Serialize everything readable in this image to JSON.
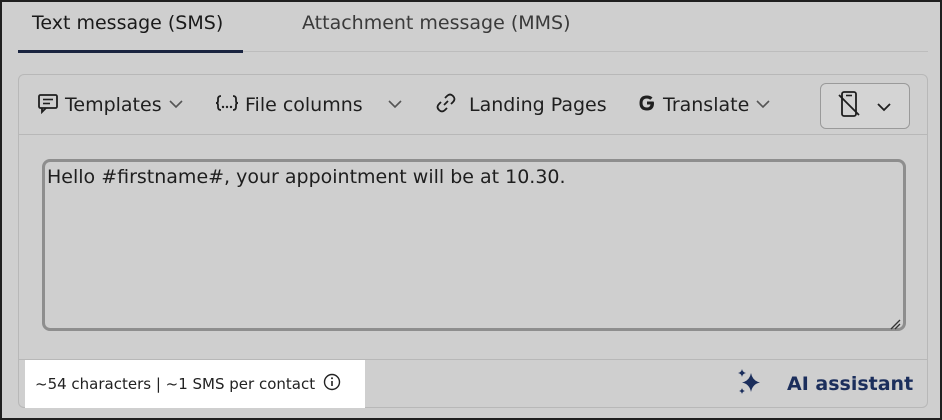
{
  "tabs": [
    {
      "label": "Text message (SMS)",
      "active": true
    },
    {
      "label": "Attachment message (MMS)",
      "active": false
    }
  ],
  "toolbar": {
    "templates_label": "Templates",
    "file_columns_label": "File columns",
    "landing_pages_label": "Landing Pages",
    "translate_label": "Translate"
  },
  "editor": {
    "message_text": "Hello #firstname#, your appointment will be at 10.30."
  },
  "footer": {
    "counter_text": "~54 characters | ~1 SMS per contact",
    "ai_assistant_label": "AI assistant"
  },
  "colors": {
    "background": "#cfcfcf",
    "accent": "#1b2e5c",
    "counter_background": "#ffffff"
  },
  "icons": [
    "message-template-icon",
    "file-columns-icon",
    "link-icon",
    "google-g-icon",
    "chevron-down-icon",
    "phone-preview-off-icon",
    "info-icon",
    "sparkles-icon"
  ]
}
